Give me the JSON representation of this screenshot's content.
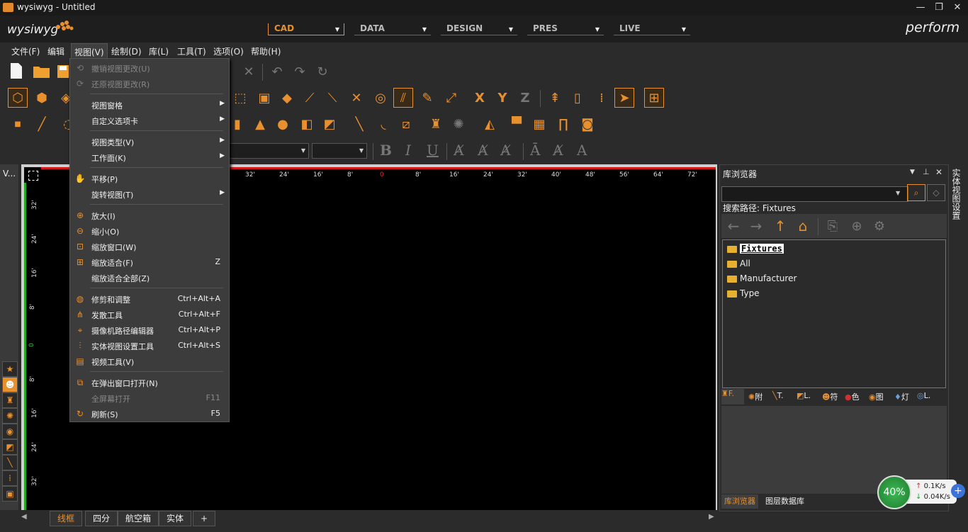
{
  "window": {
    "title": "wysiwyg - Untitled",
    "minimize": "—",
    "restore": "❐",
    "close": "✕"
  },
  "header": {
    "logo": "wysiwyg",
    "modes": [
      {
        "label": "CAD",
        "active": true
      },
      {
        "label": "DATA",
        "active": false
      },
      {
        "label": "DESIGN",
        "active": false
      },
      {
        "label": "PRES",
        "active": false
      },
      {
        "label": "LIVE",
        "active": false
      }
    ],
    "brand": "perform"
  },
  "menubar": {
    "items": [
      "文件(F)",
      "编辑",
      "视图(V)",
      "绘制(D)",
      "库(L)",
      "工具(T)",
      "选项(O)",
      "帮助(H)"
    ],
    "open_index": 2
  },
  "toolbar": {
    "axis_x": "X",
    "axis_y": "Y",
    "axis_z": "Z",
    "bold": "B",
    "italic": "I",
    "underline": "U"
  },
  "view_menu": {
    "items": [
      {
        "label": "撤销视图更改(U)",
        "shortcut": "",
        "submenu": false,
        "disabled": true,
        "icon": "undo-view-icon"
      },
      {
        "label": "还原视图更改(R)",
        "shortcut": "",
        "submenu": false,
        "disabled": true,
        "icon": "redo-view-icon"
      },
      {
        "sep": true
      },
      {
        "label": "视图窗格",
        "shortcut": "",
        "submenu": true,
        "disabled": false,
        "icon": ""
      },
      {
        "label": "自定义选项卡",
        "shortcut": "",
        "submenu": true,
        "disabled": false,
        "icon": ""
      },
      {
        "sep": true
      },
      {
        "label": "视图类型(V)",
        "shortcut": "",
        "submenu": true,
        "disabled": false,
        "icon": ""
      },
      {
        "label": "工作面(K)",
        "shortcut": "",
        "submenu": true,
        "disabled": false,
        "icon": ""
      },
      {
        "sep": true
      },
      {
        "label": "平移(P)",
        "shortcut": "",
        "submenu": false,
        "disabled": false,
        "icon": "hand-icon"
      },
      {
        "label": "旋转视图(T)",
        "shortcut": "",
        "submenu": true,
        "disabled": false,
        "icon": ""
      },
      {
        "sep": true
      },
      {
        "label": "放大(I)",
        "shortcut": "",
        "submenu": false,
        "disabled": false,
        "icon": "zoom-in-icon"
      },
      {
        "label": "缩小(O)",
        "shortcut": "",
        "submenu": false,
        "disabled": false,
        "icon": "zoom-out-icon"
      },
      {
        "label": "缩放窗口(W)",
        "shortcut": "",
        "submenu": false,
        "disabled": false,
        "icon": "zoom-window-icon"
      },
      {
        "label": "缩放适合(F)",
        "shortcut": "Z",
        "submenu": false,
        "disabled": false,
        "icon": "zoom-fit-icon"
      },
      {
        "label": "缩放适合全部(Z)",
        "shortcut": "",
        "submenu": false,
        "disabled": false,
        "icon": ""
      },
      {
        "sep": true
      },
      {
        "label": "修剪和调整",
        "shortcut": "Ctrl+Alt+A",
        "submenu": false,
        "disabled": false,
        "icon": "trim-icon"
      },
      {
        "label": "发散工具",
        "shortcut": "Ctrl+Alt+F",
        "submenu": false,
        "disabled": false,
        "icon": "spread-icon"
      },
      {
        "label": "摄像机路径编辑器",
        "shortcut": "Ctrl+Alt+P",
        "submenu": false,
        "disabled": false,
        "icon": "camera-path-icon"
      },
      {
        "label": "实体视图设置工具",
        "shortcut": "Ctrl+Alt+S",
        "submenu": false,
        "disabled": false,
        "icon": "sliders-icon"
      },
      {
        "label": "视频工具(V)",
        "shortcut": "",
        "submenu": false,
        "disabled": false,
        "icon": "film-icon"
      },
      {
        "sep": true
      },
      {
        "label": "在弹出窗口打开(N)",
        "shortcut": "",
        "submenu": false,
        "disabled": false,
        "icon": "popout-icon"
      },
      {
        "label": "全屏幕打开",
        "shortcut": "F11",
        "submenu": false,
        "disabled": true,
        "icon": ""
      },
      {
        "label": "刷新(S)",
        "shortcut": "F5",
        "submenu": false,
        "disabled": false,
        "icon": "refresh-icon"
      }
    ]
  },
  "viewport": {
    "side_label": "V...",
    "ruler_top": [
      "32'",
      "24'",
      "16'",
      "8'",
      "0",
      "8'",
      "16'",
      "24'",
      "32'",
      "40'",
      "48'",
      "56'",
      "64'",
      "72'"
    ],
    "ruler_left": [
      "32'",
      "24'",
      "16'",
      "8'",
      "0",
      "8'",
      "16'",
      "24'",
      "32'"
    ],
    "tabs": [
      "线框",
      "四分",
      "航空箱",
      "实体",
      "+"
    ],
    "active_tab": 0
  },
  "library": {
    "title": "库浏览器",
    "search_value": "",
    "path": "搜索路径: Fixtures",
    "tree": [
      {
        "label": "Fixtures",
        "root": true
      },
      {
        "label": "All",
        "root": false
      },
      {
        "label": "Manufacturer",
        "root": false
      },
      {
        "label": "Type",
        "root": false
      }
    ],
    "tabs": [
      "F.",
      "附",
      "T.",
      "L.",
      "符",
      "色",
      "图",
      "灯",
      "L."
    ],
    "bottom_tabs": [
      "库浏览器",
      "图层数据库"
    ],
    "side_tab": "实体视图设置"
  },
  "net": {
    "percent": "40%",
    "up": "0.1K/s",
    "down": "0.04K/s",
    "up_arrow": "↑",
    "down_arrow": "↓",
    "plus": "+"
  }
}
